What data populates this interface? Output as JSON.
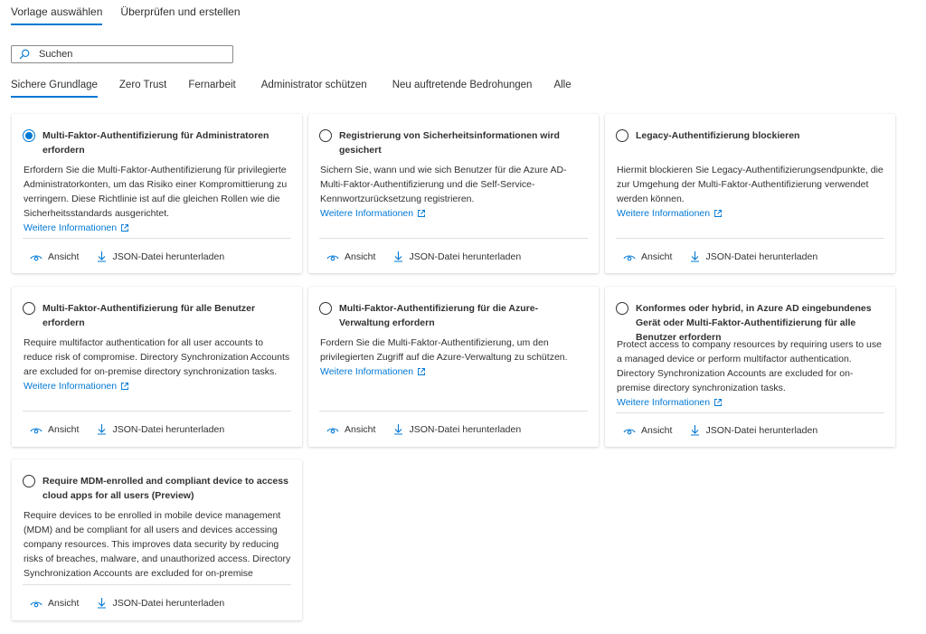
{
  "wizard_tabs": [
    "Vorlage auswählen",
    "Überprüfen und erstellen"
  ],
  "search": {
    "placeholder": "Suchen"
  },
  "category_tabs": [
    "Sichere Grundlage",
    "Zero Trust",
    "Fernarbeit",
    "Administrator schützen",
    "Neu auftretende Bedrohungen",
    "Alle"
  ],
  "common": {
    "more_info": "Weitere Informationen",
    "view_label": "Ansicht",
    "download_label": "JSON-Datei herunterladen"
  },
  "templates": [
    {
      "title": "Multi-Faktor-Authentifizierung für Administratoren erfordern",
      "description": "Erfordern Sie die Multi-Faktor-Authentifizierung für privilegierte Administratorkonten, um das Risiko einer Kompromittierung zu verringern. Diese Richtlinie ist auf die gleichen Rollen wie die Sicherheitsstandards ausgerichtet.",
      "selected": true
    },
    {
      "title": "Registrierung von Sicherheitsinformationen wird gesichert",
      "description": "Sichern Sie, wann und wie sich Benutzer für die Azure AD-Multi-Faktor-Authentifizierung und die Self-Service-Kennwortzurücksetzung registrieren.",
      "selected": false
    },
    {
      "title": "Legacy-Authentifizierung blockieren",
      "description": "Hiermit blockieren Sie Legacy-Authentifizierungsendpunkte, die zur Umgehung der Multi-Faktor-Authentifizierung verwendet werden können.",
      "selected": false
    },
    {
      "title": "Multi-Faktor-Authentifizierung für alle Benutzer erfordern",
      "description": "Require multifactor authentication for all user accounts to reduce risk of compromise. Directory Synchronization Accounts are excluded for on-premise directory synchronization tasks.",
      "selected": false
    },
    {
      "title": "Multi-Faktor-Authentifizierung für die Azure-Verwaltung erfordern",
      "description": "Fordern Sie die Multi-Faktor-Authentifizierung, um den privilegierten Zugriff auf die Azure-Verwaltung zu schützen.",
      "selected": false
    },
    {
      "title": "Konformes oder hybrid, in Azure AD eingebundenes Gerät oder Multi-Faktor-Authentifizierung für alle Benutzer erfordern",
      "description": "Protect access to company resources by requiring users to use a managed device or perform multifactor authentication. Directory Synchronization Accounts are excluded for on-premise directory synchronization tasks.",
      "selected": false
    },
    {
      "title": "Require MDM-enrolled and compliant device to access cloud apps for all users (Preview)",
      "description": "Require devices to be enrolled in mobile device management (MDM) and be compliant for all users and devices accessing company resources. This improves data security by reducing risks of breaches, malware, and unauthorized access. Directory Synchronization Accounts are excluded for on-premise",
      "selected": false
    }
  ],
  "colors": {
    "accent": "#0078d4",
    "text": "#323130",
    "divider": "#e1dfdd"
  }
}
